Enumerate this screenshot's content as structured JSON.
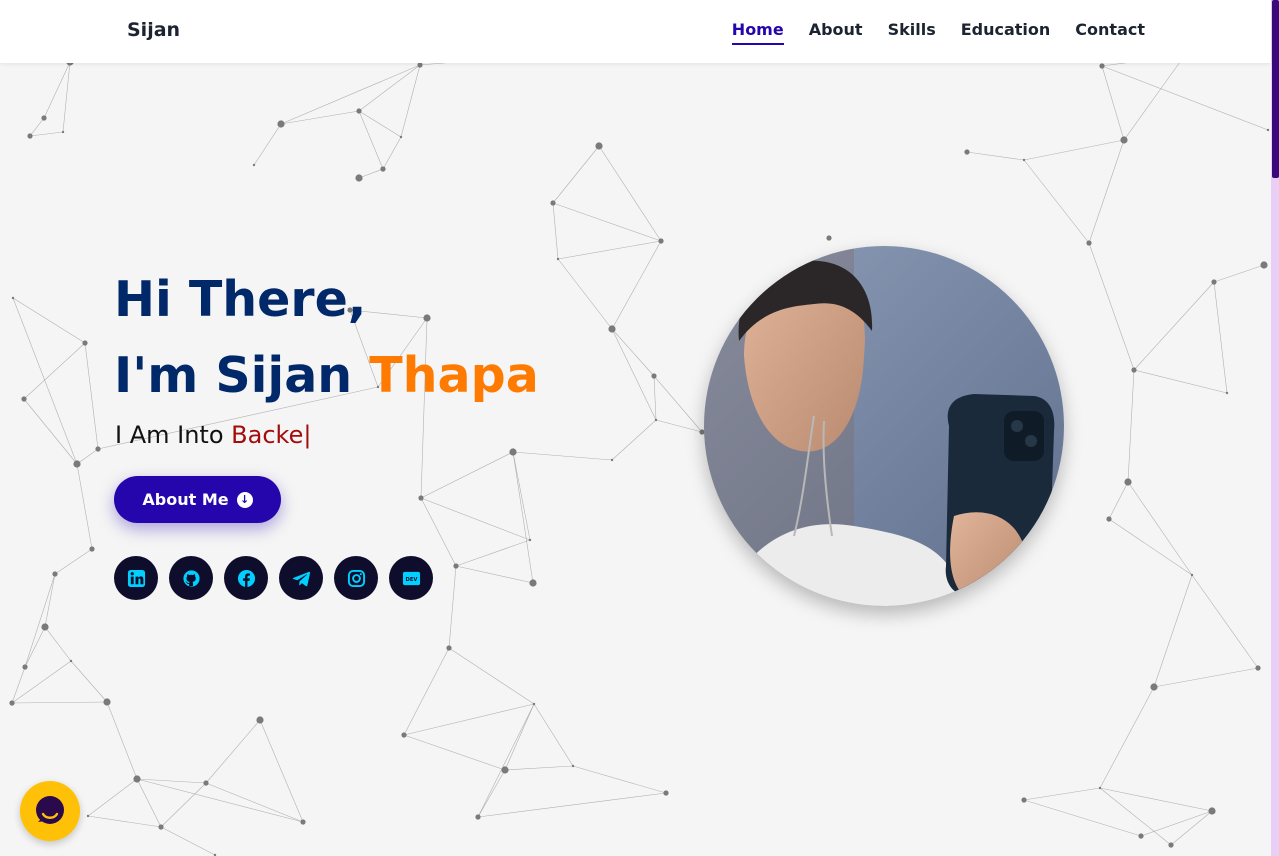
{
  "brand": "Sijan",
  "nav": {
    "items": [
      "Home",
      "About",
      "Skills",
      "Education",
      "Contact"
    ],
    "active": "Home"
  },
  "hero": {
    "greeting": "Hi There,",
    "name_prefix": "I'm Sijan ",
    "name_accent": "Thapa",
    "typed_prefix": "I Am Into ",
    "typed_word": "Backe",
    "typed_cursor": "|",
    "about_button": "About Me"
  },
  "socials": [
    "linkedin-icon",
    "github-icon",
    "facebook-icon",
    "telegram-icon",
    "instagram-icon",
    "dev-icon"
  ],
  "dev_badge": "DEV",
  "colors": {
    "primary": "#2506ad",
    "heading": "#012969",
    "accent": "#ff7a00",
    "typed": "#a30c0c",
    "social_bg": "#0e0e2c",
    "social_icon": "#00d0ff",
    "chat": "#ffc107"
  }
}
